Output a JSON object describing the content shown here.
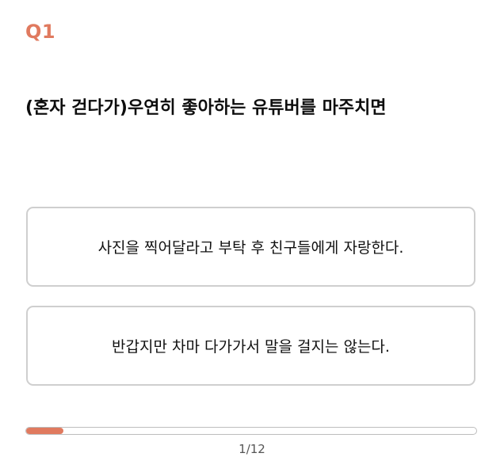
{
  "quiz": {
    "question_number": "Q1",
    "question_text": "(혼자 걷다가)우연히 좋아하는 유튜버를 마주치면",
    "answers": [
      {
        "label": "사진을 찍어달라고 부탁 후 친구들에게 자랑한다."
      },
      {
        "label": "반갑지만 차마 다가가서 말을 걸지는 않는다."
      }
    ]
  },
  "progress": {
    "current": 1,
    "total": 12,
    "label": "1/12"
  },
  "colors": {
    "accent": "#E07A5F",
    "border": "#CFCFCF",
    "muted_text": "#555555"
  }
}
